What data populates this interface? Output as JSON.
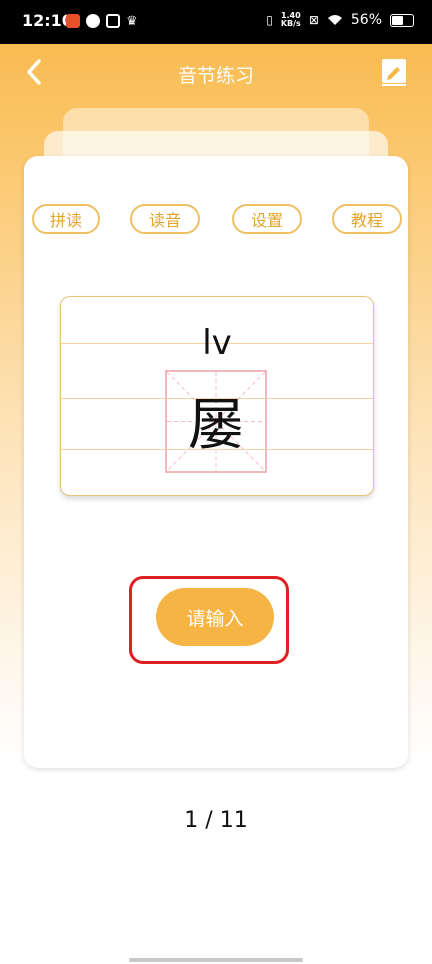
{
  "status": {
    "time": "12:10",
    "speed_value": "1.40",
    "speed_unit": "KB/s",
    "battery": "56%"
  },
  "header": {
    "title": "音节练习"
  },
  "card": {
    "buttons": [
      "拼读",
      "读音",
      "设置",
      "教程"
    ],
    "pinyin": "lv",
    "hanzi": "屡",
    "input_label": "请输入"
  },
  "pager": {
    "text": "1 / 11"
  },
  "colors": {
    "accent": "#f5b444",
    "pill_border": "#f0c060",
    "highlight": "#e02020"
  },
  "icons": {
    "back": "chevron-left-icon",
    "edit": "edit-note-icon"
  }
}
